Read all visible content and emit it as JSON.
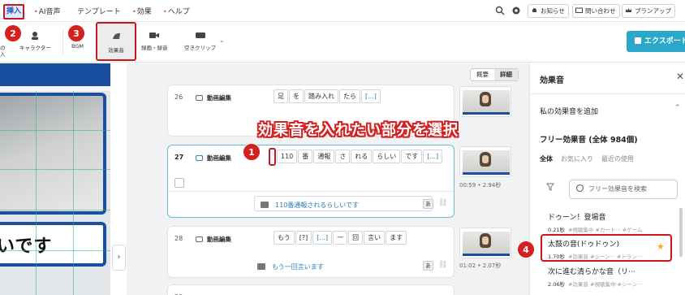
{
  "menu": {
    "insert": "挿入",
    "items": [
      "AI音声",
      "テンプレート",
      "効果",
      "ヘルプ"
    ],
    "notice": "お知らせ",
    "contact": "問い合わせ",
    "plan_up": "プランアップ"
  },
  "toolbar": {
    "partial_left": "の\n入",
    "character": "キャラクター",
    "bgm": "BGM",
    "sfx": "効果音",
    "record": "録画・録音",
    "empty_clip": "空きクリップ",
    "export": "エクスポート"
  },
  "callouts": {
    "c1": "1",
    "c2": "2",
    "c3": "3",
    "c4": "4"
  },
  "preview": {
    "caption": "いです"
  },
  "editor": {
    "view_toggle": {
      "overview": "概要",
      "detail": "詳細"
    },
    "rows": [
      {
        "num": "26",
        "label": "動画編集",
        "words": [
          "足",
          "を",
          "踏み入れ",
          "たら",
          "[...]"
        ]
      },
      {
        "num": "27",
        "label": "動画編集",
        "words": [
          "110",
          "番",
          "通報",
          "さ",
          "れる",
          "らしい",
          "です",
          "[...]"
        ],
        "subtitle": "110番通報されるらしいです",
        "time": "00:59 • 2.94秒"
      },
      {
        "num": "28",
        "label": "動画編集",
        "words": [
          "もう",
          "[?]",
          "[...]",
          "一",
          "回",
          "言い",
          "ます"
        ],
        "subtitle": "もう一回言います",
        "time": "01:02 • 2.07秒"
      },
      {
        "num": "29"
      }
    ],
    "a_label": "あ",
    "overlay": "効果音を入れたい部分を選択"
  },
  "panel": {
    "title": "効果音",
    "add_mine": "私の効果音を追加",
    "free_title": "フリー効果音 (全体 984個)",
    "tabs": [
      "全体",
      "お気に入り",
      "最近の使用"
    ],
    "search_placeholder": "フリー効果音を検索",
    "sounds": [
      {
        "name": "ドゥーン！登場音",
        "dur": "0.21秒",
        "tags": "#視聴集中 #カート··· #ゲーム"
      },
      {
        "name": "太鼓の音(ドゥドゥン)",
        "dur": "1.70秒",
        "tags": "#効果音 #シーン··· #トラン···"
      },
      {
        "name": "次に進む清らかな音（リ···",
        "dur": "2.06秒",
        "tags": "#効果音 #視聴集中 #シーン···"
      }
    ]
  },
  "colors": {
    "accent": "#2aa7c9",
    "callout": "#d6201f",
    "brand_blue": "#1a4fa0"
  }
}
